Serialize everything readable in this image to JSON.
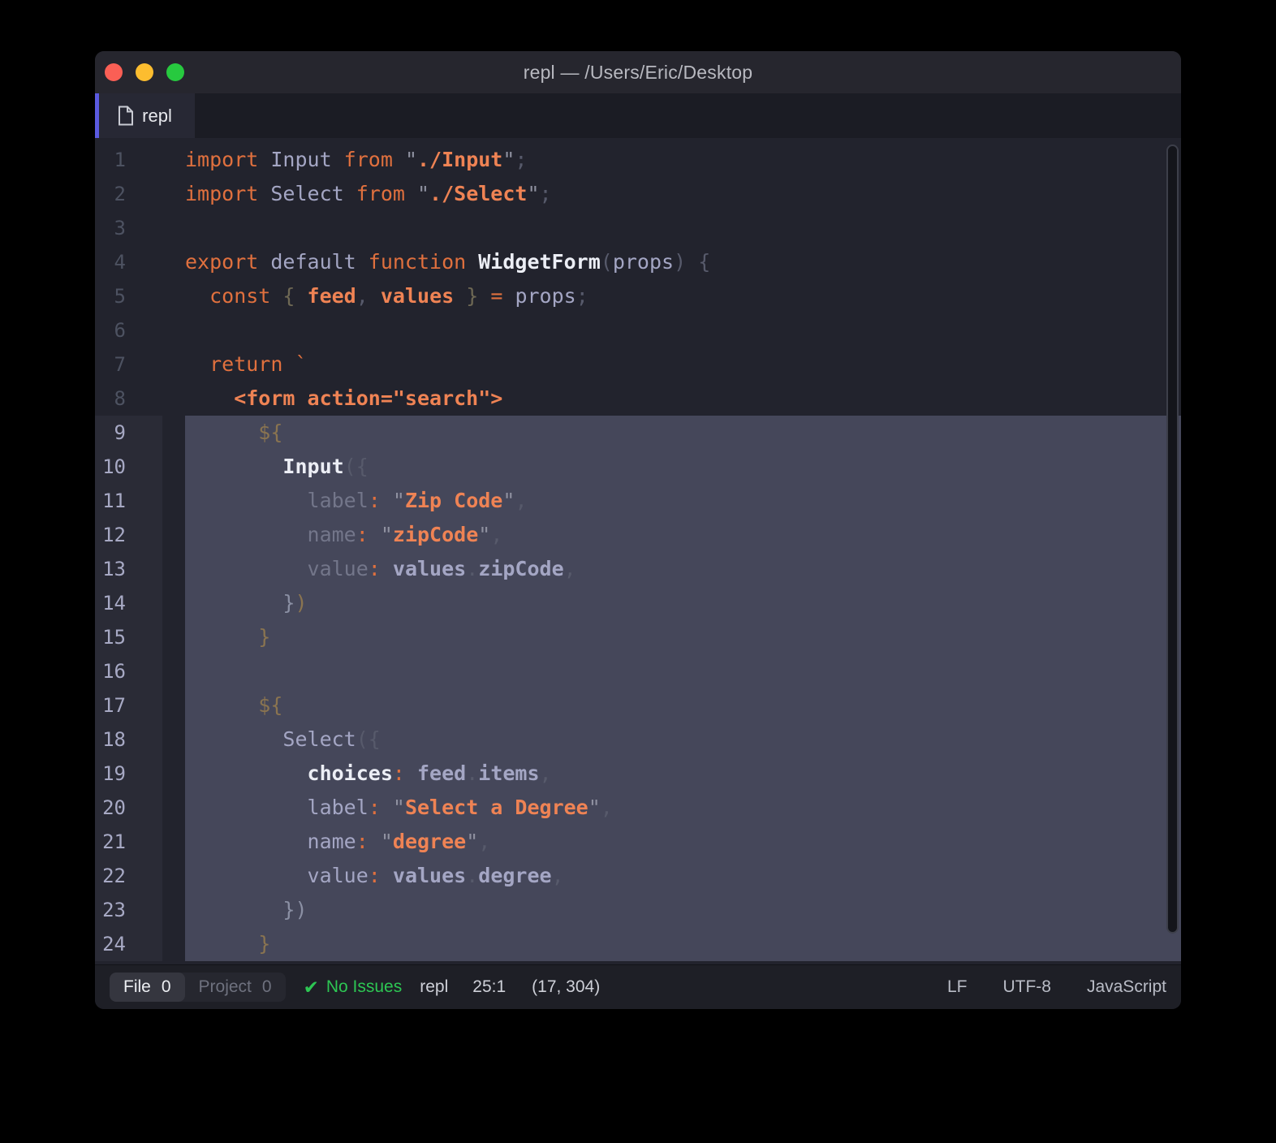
{
  "window": {
    "title": "repl — /Users/Eric/Desktop"
  },
  "tab": {
    "label": "repl"
  },
  "palette": {
    "accent_purple": "#5a5ae0",
    "keyword_orange": "#e0703e",
    "string_orange": "#ef8354",
    "identifier_lavender": "#a4a6c4",
    "selection_bg": "#45475a",
    "editor_bg": "#22232d",
    "success_green": "#2dc653",
    "traffic_red": "#fa5f55",
    "traffic_yellow": "#fcbd2f",
    "traffic_green": "#27c93f"
  },
  "editor": {
    "selected_lines": "9-24",
    "lines": [
      {
        "n": 1,
        "sel": false,
        "tokens": [
          [
            "k",
            "import "
          ],
          [
            "i",
            "Input "
          ],
          [
            "k",
            "from "
          ],
          [
            "q",
            "\""
          ],
          [
            "s",
            "./Input"
          ],
          [
            "q",
            "\""
          ],
          [
            "p",
            ";"
          ]
        ]
      },
      {
        "n": 2,
        "sel": false,
        "tokens": [
          [
            "k",
            "import "
          ],
          [
            "i",
            "Select "
          ],
          [
            "k",
            "from "
          ],
          [
            "q",
            "\""
          ],
          [
            "s",
            "./Select"
          ],
          [
            "q",
            "\""
          ],
          [
            "p",
            ";"
          ]
        ]
      },
      {
        "n": 3,
        "sel": false,
        "tokens": []
      },
      {
        "n": 4,
        "sel": false,
        "tokens": [
          [
            "k",
            "export "
          ],
          [
            "i",
            "default "
          ],
          [
            "k",
            "function "
          ],
          [
            "w",
            "WidgetForm"
          ],
          [
            "p",
            "("
          ],
          [
            "i",
            "props"
          ],
          [
            "p",
            ") {"
          ]
        ]
      },
      {
        "n": 5,
        "sel": false,
        "tokens": [
          [
            "k",
            "  const "
          ],
          [
            "o",
            "{ "
          ],
          [
            "s",
            "feed"
          ],
          [
            "p",
            ", "
          ],
          [
            "s",
            "values"
          ],
          [
            "o",
            " }"
          ],
          [
            "k",
            " = "
          ],
          [
            "i",
            "props"
          ],
          [
            "p",
            ";"
          ]
        ]
      },
      {
        "n": 6,
        "sel": false,
        "tokens": []
      },
      {
        "n": 7,
        "sel": false,
        "tokens": [
          [
            "k",
            "  return `"
          ]
        ]
      },
      {
        "n": 8,
        "sel": false,
        "tokens": [
          [
            "s",
            "    <form action=\"search\">"
          ]
        ]
      },
      {
        "n": 9,
        "sel": true,
        "tokens": [
          [
            "t",
            "      ${"
          ]
        ]
      },
      {
        "n": 10,
        "sel": true,
        "tokens": [
          [
            "w",
            "        Input"
          ],
          [
            "p",
            "({"
          ]
        ]
      },
      {
        "n": 11,
        "sel": true,
        "tokens": [
          [
            "d",
            "          label"
          ],
          [
            "k",
            ":"
          ],
          [
            "q",
            " \""
          ],
          [
            "s",
            "Zip Code"
          ],
          [
            "q",
            "\""
          ],
          [
            "p",
            ","
          ]
        ]
      },
      {
        "n": 12,
        "sel": true,
        "tokens": [
          [
            "d",
            "          name"
          ],
          [
            "k",
            ":"
          ],
          [
            "q",
            " \""
          ],
          [
            "s",
            "zipCode"
          ],
          [
            "q",
            "\""
          ],
          [
            "p",
            ","
          ]
        ]
      },
      {
        "n": 13,
        "sel": true,
        "tokens": [
          [
            "d",
            "          value"
          ],
          [
            "k",
            ":"
          ],
          [
            "b",
            " values"
          ],
          [
            "p",
            "."
          ],
          [
            "b",
            "zipCode"
          ],
          [
            "p",
            ","
          ]
        ]
      },
      {
        "n": 14,
        "sel": true,
        "tokens": [
          [
            "g",
            "        }"
          ],
          [
            "t",
            ")"
          ]
        ]
      },
      {
        "n": 15,
        "sel": true,
        "tokens": [
          [
            "t",
            "      }"
          ]
        ]
      },
      {
        "n": 16,
        "sel": true,
        "tokens": []
      },
      {
        "n": 17,
        "sel": true,
        "tokens": [
          [
            "t",
            "      ${"
          ]
        ]
      },
      {
        "n": 18,
        "sel": true,
        "tokens": [
          [
            "i",
            "        Select"
          ],
          [
            "p",
            "({"
          ]
        ]
      },
      {
        "n": 19,
        "sel": true,
        "tokens": [
          [
            "w",
            "          choices"
          ],
          [
            "k",
            ":"
          ],
          [
            "b",
            " feed"
          ],
          [
            "p",
            "."
          ],
          [
            "b",
            "items"
          ],
          [
            "p",
            ","
          ]
        ]
      },
      {
        "n": 20,
        "sel": true,
        "tokens": [
          [
            "i",
            "          label"
          ],
          [
            "k",
            ":"
          ],
          [
            "q",
            " \""
          ],
          [
            "s",
            "Select a Degree"
          ],
          [
            "q",
            "\""
          ],
          [
            "p",
            ","
          ]
        ]
      },
      {
        "n": 21,
        "sel": true,
        "tokens": [
          [
            "i",
            "          name"
          ],
          [
            "k",
            ":"
          ],
          [
            "q",
            " \""
          ],
          [
            "s",
            "degree"
          ],
          [
            "q",
            "\""
          ],
          [
            "p",
            ","
          ]
        ]
      },
      {
        "n": 22,
        "sel": true,
        "tokens": [
          [
            "i",
            "          value"
          ],
          [
            "k",
            ":"
          ],
          [
            "b",
            " values"
          ],
          [
            "p",
            "."
          ],
          [
            "b",
            "degree"
          ],
          [
            "p",
            ","
          ]
        ]
      },
      {
        "n": 23,
        "sel": true,
        "tokens": [
          [
            "g",
            "        })"
          ]
        ]
      },
      {
        "n": 24,
        "sel": true,
        "tokens": [
          [
            "t",
            "      }"
          ]
        ]
      }
    ]
  },
  "statusbar": {
    "file_label": "File",
    "file_count": "0",
    "project_label": "Project",
    "project_count": "0",
    "check_glyph": "✔",
    "no_issues_label": "No Issues",
    "doc_name": "repl",
    "cursor_position": "25:1",
    "selection_info": "(17, 304)",
    "line_ending": "LF",
    "encoding": "UTF-8",
    "language": "JavaScript"
  }
}
